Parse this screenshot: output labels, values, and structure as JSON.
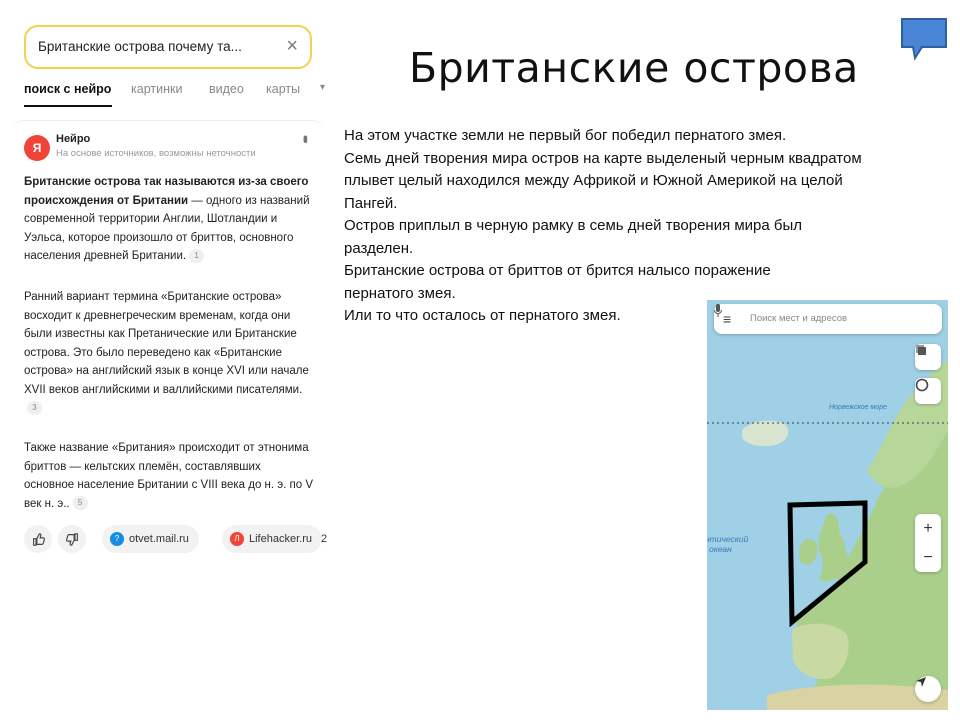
{
  "search": {
    "query": "Британские острова почему та...",
    "clear_icon": "close-icon"
  },
  "tabs": [
    {
      "label": "поиск с нейро",
      "active": true
    },
    {
      "label": "картинки",
      "active": false
    },
    {
      "label": "видео",
      "active": false
    },
    {
      "label": "карты",
      "active": false
    }
  ],
  "answer": {
    "source_name": "Нейро",
    "source_note": "На основе источников, возможны неточности",
    "para1_bold": "Британские острова так называются из-за своего происхождения от Британии",
    "para1_rest": " — одного из названий современной территории Англии, Шотландии и Уэльса, которое произошло от бриттов, основного населения древней Британии.",
    "para1_ref": "1",
    "para2": "Ранний вариант термина «Британские острова» восходит к древнегреческим временам, когда они были известны как Претанические или Британские острова. Это было переведено как «Британские острова» на английский язык в конце XVI или начале XVII веков английскими и валлийскими писателями.",
    "para2_ref": "3",
    "para3": "Также название «Британия» происходит от этнонима бриттов — кельтских племён, составлявших основное население Британии с VIII века до н. э. по V век н. э..",
    "para3_ref": "5",
    "sources": [
      {
        "label": "otvet.mail.ru",
        "color": "#168de2"
      },
      {
        "label": "Lifehacker.ru",
        "color": "#f04438"
      }
    ],
    "overflow_count": "2"
  },
  "slide": {
    "title": "Британские острова",
    "lines": [
      "На этом участке земли не первый бог победил пернатого змея.",
      "Семь дней творения мира остров на карте выделеный черным квадратом плывет целый находился между Африкой и Южной Америкой на целой Пангей.",
      "Остров приплыл в черную рамку в семь дней творения мира был разделен.",
      "Британские острова от бриттов от брится налысо поражение пернатого змея.",
      "Или то что осталось от пернатого змея."
    ]
  },
  "map": {
    "search_placeholder": "Поиск мест и адресов",
    "label_sea": "Норвежское море",
    "label_ocean_1": "нтический",
    "label_ocean_2": "океан",
    "zoom_in": "+",
    "zoom_out": "−"
  },
  "colors": {
    "search_border": "#f2d24b",
    "bubble": "#4a86d8",
    "sea": "#9fd0e6",
    "land": "#a9cf8a"
  }
}
